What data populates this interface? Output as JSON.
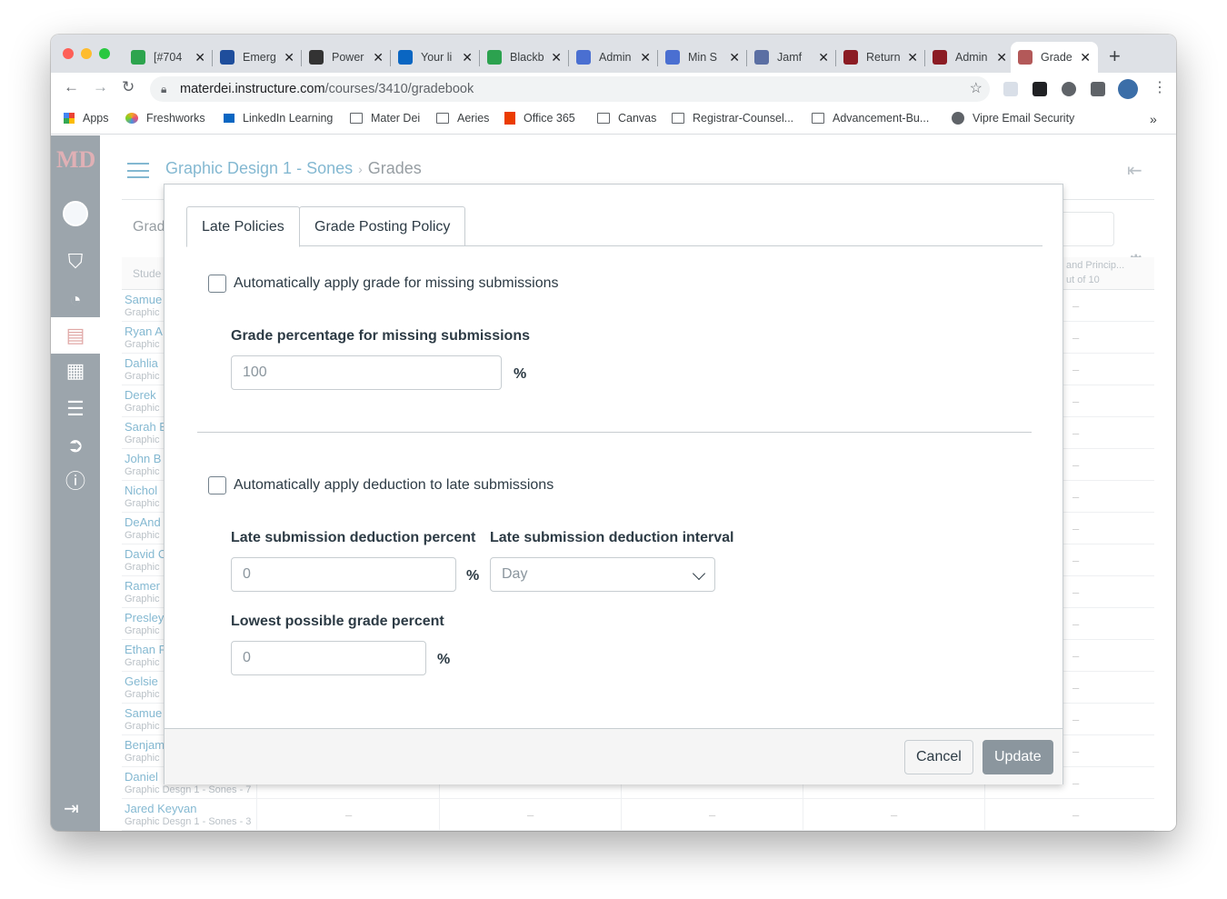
{
  "browser": {
    "tabs": [
      {
        "title": "[#704",
        "color": "#2da44e"
      },
      {
        "title": "Emerg",
        "color": "#1f4e9c"
      },
      {
        "title": "Power",
        "color": "#333333"
      },
      {
        "title": "Your li",
        "color": "#0a66c2"
      },
      {
        "title": "Blackb",
        "color": "#2ca24f"
      },
      {
        "title": "Admin",
        "color": "#4a6fd1"
      },
      {
        "title": "Min S",
        "color": "#4a6fd1"
      },
      {
        "title": "Jamf",
        "color": "#5b6fa3"
      },
      {
        "title": "Return",
        "color": "#8b1c24"
      },
      {
        "title": "Admin",
        "color": "#8b1c24"
      },
      {
        "title": "Grade",
        "color": "#b35959"
      }
    ],
    "url_host": "materdei.instructure.com",
    "url_path": "/courses/3410/gradebook",
    "bookmarks": [
      "Apps",
      "Freshworks",
      "LinkedIn Learning",
      "Mater Dei",
      "Aeries",
      "Office 365",
      "Canvas",
      "Registrar-Counsel...",
      "Advancement-Bu...",
      "Vipre Email Security"
    ],
    "bookmarks_more": "»"
  },
  "canvas": {
    "logo": "MD",
    "breadcrumb_course": "Graphic Design 1 - Sones",
    "breadcrumb_sep": "›",
    "breadcrumb_current": "Grades",
    "grade_header_partial": "Grad",
    "student_col_partial": "Stude",
    "assignment_col_partial": "and Princip...",
    "assignment_points_partial": "ut of 10",
    "students": [
      {
        "name": "Samue",
        "section": "Graphic"
      },
      {
        "name": "Ryan A",
        "section": "Graphic"
      },
      {
        "name": "Dahlia",
        "section": "Graphic"
      },
      {
        "name": "Derek",
        "section": "Graphic"
      },
      {
        "name": "Sarah E",
        "section": "Graphic"
      },
      {
        "name": "John B",
        "section": "Graphic"
      },
      {
        "name": "Nichol",
        "section": "Graphic"
      },
      {
        "name": "DeAnd",
        "section": "Graphic"
      },
      {
        "name": "David C",
        "section": "Graphic"
      },
      {
        "name": "Ramer",
        "section": "Graphic"
      },
      {
        "name": "Presley",
        "section": "Graphic"
      },
      {
        "name": "Ethan F",
        "section": "Graphic"
      },
      {
        "name": "Gelsie",
        "section": "Graphic"
      },
      {
        "name": "Samue",
        "section": "Graphic"
      },
      {
        "name": "Benjam",
        "section": "Graphic"
      },
      {
        "name": "Daniel",
        "section": "Graphic Desgn 1 - Sones - 7"
      },
      {
        "name": "Jared Keyvan",
        "section": "Graphic Desgn 1 - Sones - 3"
      }
    ],
    "empty_grade": "–"
  },
  "modal": {
    "tabs": [
      "Late Policies",
      "Grade Posting Policy"
    ],
    "missing_checkbox_label": "Automatically apply grade for missing submissions",
    "missing_pct_label": "Grade percentage for missing submissions",
    "missing_pct_value": "100",
    "late_checkbox_label": "Automatically apply deduction to late submissions",
    "late_deduction_label": "Late submission deduction percent",
    "late_deduction_value": "0",
    "late_interval_label": "Late submission deduction interval",
    "late_interval_value": "Day",
    "lowest_grade_label": "Lowest possible grade percent",
    "lowest_grade_value": "0",
    "percent_sign": "%",
    "cancel_label": "Cancel",
    "update_label": "Update"
  }
}
